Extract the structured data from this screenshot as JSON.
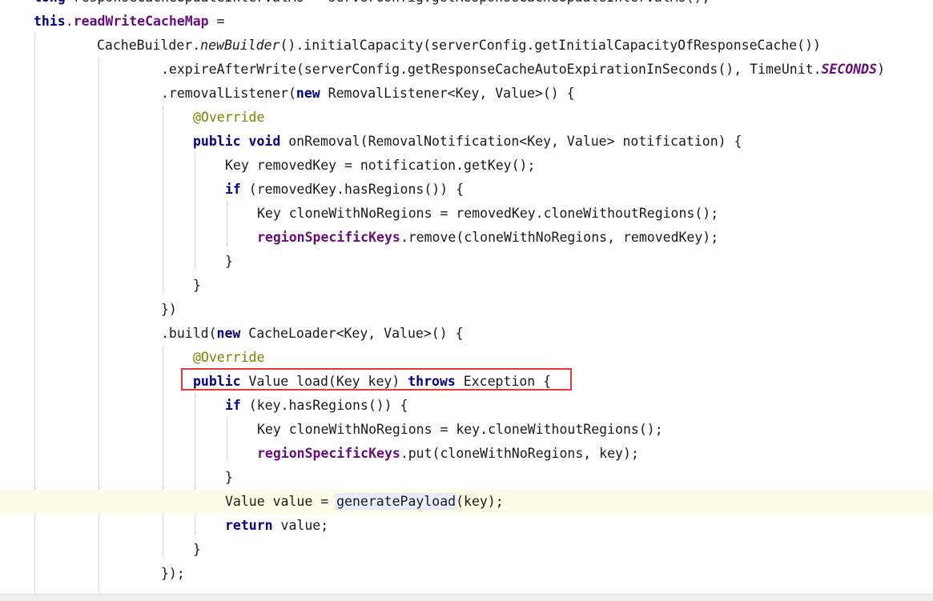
{
  "editor": {
    "lines": [
      {
        "tokens": [
          {
            "t": "long ",
            "c": "kw"
          },
          {
            "t": "responseCacheUpdateIntervalMs = serverConfig.getResponseCacheUpdateIntervalMs();"
          }
        ]
      },
      {
        "tokens": [
          {
            "t": "this",
            "c": "kw"
          },
          {
            "t": "."
          },
          {
            "t": "readWriteCacheMap",
            "c": "fld"
          },
          {
            "t": " ="
          }
        ]
      },
      {
        "tokens": [
          {
            "t": "CacheBuilder."
          },
          {
            "t": "newBuilder",
            "c": "stat"
          },
          {
            "t": "().initialCapacity(serverConfig.getInitialCapacityOfResponseCache())"
          }
        ]
      },
      {
        "tokens": [
          {
            "t": ".expireAfterWrite(serverConfig.getResponseCacheAutoExpirationInSeconds(), TimeUnit."
          },
          {
            "t": "SECONDS",
            "c": "sfld"
          },
          {
            "t": ")"
          }
        ]
      },
      {
        "tokens": [
          {
            "t": ".removalListener("
          },
          {
            "t": "new",
            "c": "kw"
          },
          {
            "t": " RemovalListener<Key, Value>() {"
          }
        ]
      },
      {
        "tokens": [
          {
            "t": "@Override",
            "c": "ann"
          }
        ]
      },
      {
        "tokens": [
          {
            "t": "public",
            "c": "kw"
          },
          {
            "t": " "
          },
          {
            "t": "void",
            "c": "kw"
          },
          {
            "t": " onRemoval(RemovalNotification<Key, Value> notification) {"
          }
        ]
      },
      {
        "tokens": [
          {
            "t": "Key removedKey = notification.getKey();"
          }
        ]
      },
      {
        "tokens": [
          {
            "t": "if",
            "c": "kw"
          },
          {
            "t": " (removedKey.hasRegions()) {"
          }
        ]
      },
      {
        "tokens": [
          {
            "t": "Key cloneWithNoRegions = removedKey.cloneWithoutRegions();"
          }
        ]
      },
      {
        "tokens": [
          {
            "t": "regionSpecificKeys",
            "c": "fld"
          },
          {
            "t": ".remove(cloneWithNoRegions, removedKey);"
          }
        ]
      },
      {
        "tokens": [
          {
            "t": "}"
          }
        ]
      },
      {
        "tokens": [
          {
            "t": "}"
          }
        ]
      },
      {
        "tokens": [
          {
            "t": "})"
          }
        ]
      },
      {
        "tokens": [
          {
            "t": ".build("
          },
          {
            "t": "new",
            "c": "kw"
          },
          {
            "t": " CacheLoader<Key, Value>() {"
          }
        ]
      },
      {
        "tokens": [
          {
            "t": "@Override",
            "c": "ann"
          }
        ]
      },
      {
        "tokens": [
          {
            "t": "public",
            "c": "kw"
          },
          {
            "t": " Value load(Key key) "
          },
          {
            "t": "throws",
            "c": "kw"
          },
          {
            "t": " Exception {"
          }
        ]
      },
      {
        "tokens": [
          {
            "t": "if",
            "c": "kw"
          },
          {
            "t": " (key.hasRegions()) {"
          }
        ]
      },
      {
        "tokens": [
          {
            "t": "Key cloneWithNoRegions = key.cloneWithoutRegions();"
          }
        ]
      },
      {
        "tokens": [
          {
            "t": "regionSpecificKeys",
            "c": "fld"
          },
          {
            "t": ".put(cloneWithNoRegions, key);"
          }
        ]
      },
      {
        "tokens": [
          {
            "t": "}"
          }
        ]
      },
      {
        "tokens": [
          {
            "t": "Value value = "
          },
          {
            "t": "generatePayload",
            "c": "hl"
          },
          {
            "t": "(key);"
          }
        ]
      },
      {
        "tokens": [
          {
            "t": "return",
            "c": "kw"
          },
          {
            "t": " value;"
          }
        ]
      },
      {
        "tokens": [
          {
            "t": "}"
          }
        ]
      },
      {
        "tokens": [
          {
            "t": "});"
          }
        ]
      }
    ]
  }
}
